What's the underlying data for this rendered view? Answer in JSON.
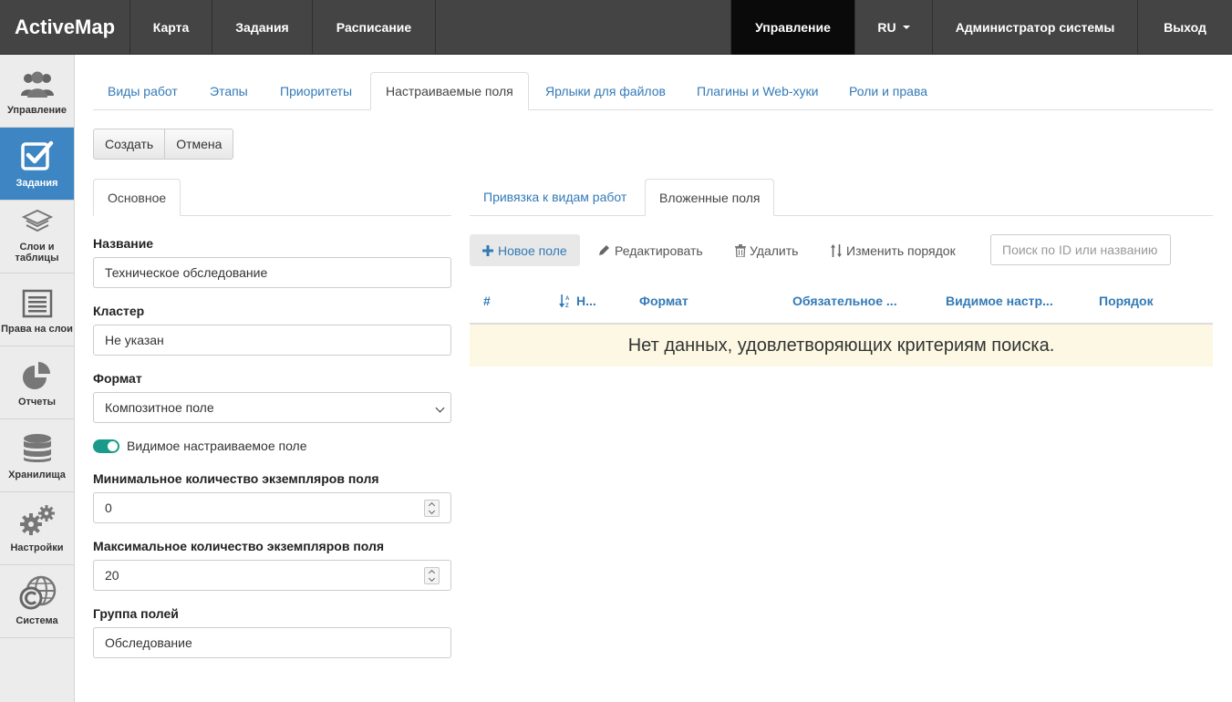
{
  "navbar": {
    "brand": "ActiveMap",
    "items": [
      {
        "label": "Карта"
      },
      {
        "label": "Задания"
      },
      {
        "label": "Расписание"
      }
    ],
    "right_items": [
      {
        "label": "Управление"
      },
      {
        "label": "RU"
      },
      {
        "label": "Администратор системы"
      },
      {
        "label": "Выход"
      }
    ]
  },
  "sidebar": {
    "items": [
      {
        "label": "Управление",
        "icon": "users-icon"
      },
      {
        "label": "Задания",
        "icon": "checkbox-icon"
      },
      {
        "label": "Слои и таблицы",
        "line1": "Слои и",
        "line2": "таблицы",
        "icon": "layers-icon"
      },
      {
        "label": "Права на слои",
        "icon": "list-icon"
      },
      {
        "label": "Отчеты",
        "icon": "pie-chart-icon"
      },
      {
        "label": "Хранилища",
        "icon": "database-icon"
      },
      {
        "label": "Настройки",
        "icon": "gears-icon"
      },
      {
        "label": "Система",
        "icon": "globe-copyright-icon"
      }
    ]
  },
  "tabs": [
    {
      "label": "Виды работ"
    },
    {
      "label": "Этапы"
    },
    {
      "label": "Приоритеты"
    },
    {
      "label": "Настраиваемые поля"
    },
    {
      "label": "Ярлыки для файлов"
    },
    {
      "label": "Плагины и Web-хуки"
    },
    {
      "label": "Роли и права"
    }
  ],
  "actions": {
    "create": "Создать",
    "cancel": "Отмена"
  },
  "form": {
    "tab_label": "Основное",
    "name": {
      "label": "Название",
      "value": "Техническое обследование"
    },
    "cluster": {
      "label": "Кластер",
      "value": "Не указан"
    },
    "format": {
      "label": "Формат",
      "value": "Композитное поле"
    },
    "visible_toggle": {
      "label": "Видимое настраиваемое поле"
    },
    "min_instances": {
      "label": "Минимальное количество экземпляров поля",
      "value": "0"
    },
    "max_instances": {
      "label": "Максимальное количество экземпляров поля",
      "value": "20"
    },
    "group": {
      "label": "Группа полей",
      "value": "Обследование"
    }
  },
  "nested": {
    "tabs": [
      {
        "label": "Привязка к видам работ"
      },
      {
        "label": "Вложенные поля"
      }
    ],
    "toolbar": {
      "new_field": "Новое поле",
      "edit": "Редактировать",
      "delete": "Удалить",
      "reorder": "Изменить порядок",
      "search_placeholder": "Поиск по ID или названию"
    },
    "columns": [
      "#",
      "Н...",
      "Формат",
      "Обязательное ...",
      "Видимое настр...",
      "Порядок"
    ],
    "empty_message": "Нет данных, удовлетворяющих критериям поиска."
  }
}
